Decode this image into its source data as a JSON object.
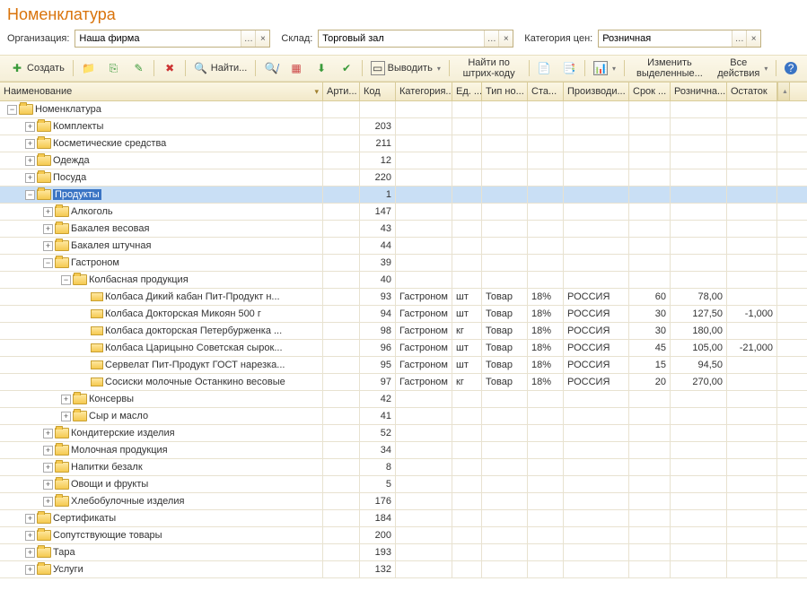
{
  "title": "Номенклатура",
  "filters": {
    "org_label": "Организация:",
    "org_value": "Наша фирма",
    "wh_label": "Склад:",
    "wh_value": "Торговый зал",
    "cat_label": "Категория цен:",
    "cat_value": "Розничная"
  },
  "toolbar": {
    "create": "Создать",
    "find": "Найти...",
    "output": "Выводить",
    "barcode": "Найти по штрих-коду",
    "change": "Изменить выделенные...",
    "all": "Все действия"
  },
  "columns": {
    "c0": "Наименование",
    "c1": "Арти...",
    "c2": "Код",
    "c3": "Категория...",
    "c4": "Ед. ...",
    "c5": "Тип но...",
    "c6": "Ста...",
    "c7": "Производи...",
    "c8": "Срок ...",
    "c9": "Рознична...",
    "c10": "Остаток"
  },
  "rows": [
    {
      "type": "folder",
      "depth": 0,
      "exp": "-",
      "sel": false,
      "name": "Номенклатура",
      "code": ""
    },
    {
      "type": "folder",
      "depth": 1,
      "exp": "+",
      "sel": false,
      "name": "Комплекты",
      "code": "203"
    },
    {
      "type": "folder",
      "depth": 1,
      "exp": "+",
      "sel": false,
      "name": "Косметические средства",
      "code": "211"
    },
    {
      "type": "folder",
      "depth": 1,
      "exp": "+",
      "sel": false,
      "name": "Одежда",
      "code": "12"
    },
    {
      "type": "folder",
      "depth": 1,
      "exp": "+",
      "sel": false,
      "name": "Посуда",
      "code": "220"
    },
    {
      "type": "folder",
      "depth": 1,
      "exp": "-",
      "sel": true,
      "name": "Продукты",
      "code": "1"
    },
    {
      "type": "folder",
      "depth": 2,
      "exp": "+",
      "sel": false,
      "name": "Алкоголь",
      "code": "147"
    },
    {
      "type": "folder",
      "depth": 2,
      "exp": "+",
      "sel": false,
      "name": "Бакалея весовая",
      "code": "43"
    },
    {
      "type": "folder",
      "depth": 2,
      "exp": "+",
      "sel": false,
      "name": "Бакалея штучная",
      "code": "44"
    },
    {
      "type": "folder",
      "depth": 2,
      "exp": "-",
      "sel": false,
      "name": "Гастроном",
      "code": "39"
    },
    {
      "type": "folder",
      "depth": 3,
      "exp": "-",
      "sel": false,
      "name": "Колбасная продукция",
      "code": "40"
    },
    {
      "type": "item",
      "depth": 4,
      "exp": "",
      "sel": false,
      "name": "Колбаса Дикий кабан Пит-Продукт н...",
      "code": "93",
      "cat": "Гастроном",
      "unit": "шт",
      "nt": "Товар",
      "vat": "18%",
      "prod": "РОССИЯ",
      "srok": "60",
      "price": "78,00",
      "rest": ""
    },
    {
      "type": "item",
      "depth": 4,
      "exp": "",
      "sel": false,
      "name": "Колбаса Докторская Микоян 500 г",
      "code": "94",
      "cat": "Гастроном",
      "unit": "шт",
      "nt": "Товар",
      "vat": "18%",
      "prod": "РОССИЯ",
      "srok": "30",
      "price": "127,50",
      "rest": "-1,000"
    },
    {
      "type": "item",
      "depth": 4,
      "exp": "",
      "sel": false,
      "name": "Колбаса докторская Петербурженка ...",
      "code": "98",
      "cat": "Гастроном",
      "unit": "кг",
      "nt": "Товар",
      "vat": "18%",
      "prod": "РОССИЯ",
      "srok": "30",
      "price": "180,00",
      "rest": ""
    },
    {
      "type": "item",
      "depth": 4,
      "exp": "",
      "sel": false,
      "name": "Колбаса Царицыно Советская сырок...",
      "code": "96",
      "cat": "Гастроном",
      "unit": "шт",
      "nt": "Товар",
      "vat": "18%",
      "prod": "РОССИЯ",
      "srok": "45",
      "price": "105,00",
      "rest": "-21,000"
    },
    {
      "type": "item",
      "depth": 4,
      "exp": "",
      "sel": false,
      "name": "Сервелат Пит-Продукт ГОСТ нарезка...",
      "code": "95",
      "cat": "Гастроном",
      "unit": "шт",
      "nt": "Товар",
      "vat": "18%",
      "prod": "РОССИЯ",
      "srok": "15",
      "price": "94,50",
      "rest": ""
    },
    {
      "type": "item",
      "depth": 4,
      "exp": "",
      "sel": false,
      "name": "Сосиски молочные Останкино весовые",
      "code": "97",
      "cat": "Гастроном",
      "unit": "кг",
      "nt": "Товар",
      "vat": "18%",
      "prod": "РОССИЯ",
      "srok": "20",
      "price": "270,00",
      "rest": ""
    },
    {
      "type": "folder",
      "depth": 3,
      "exp": "+",
      "sel": false,
      "name": "Консервы",
      "code": "42"
    },
    {
      "type": "folder",
      "depth": 3,
      "exp": "+",
      "sel": false,
      "name": "Сыр и масло",
      "code": "41"
    },
    {
      "type": "folder",
      "depth": 2,
      "exp": "+",
      "sel": false,
      "name": "Кондитерские изделия",
      "code": "52"
    },
    {
      "type": "folder",
      "depth": 2,
      "exp": "+",
      "sel": false,
      "name": "Молочная продукция",
      "code": "34"
    },
    {
      "type": "folder",
      "depth": 2,
      "exp": "+",
      "sel": false,
      "name": "Напитки безалк",
      "code": "8"
    },
    {
      "type": "folder",
      "depth": 2,
      "exp": "+",
      "sel": false,
      "name": "Овощи и фрукты",
      "code": "5"
    },
    {
      "type": "folder",
      "depth": 2,
      "exp": "+",
      "sel": false,
      "name": "Хлебобулочные изделия",
      "code": "176"
    },
    {
      "type": "folder",
      "depth": 1,
      "exp": "+",
      "sel": false,
      "name": "Сертификаты",
      "code": "184"
    },
    {
      "type": "folder",
      "depth": 1,
      "exp": "+",
      "sel": false,
      "name": "Сопутствующие товары",
      "code": "200"
    },
    {
      "type": "folder",
      "depth": 1,
      "exp": "+",
      "sel": false,
      "name": "Тара",
      "code": "193"
    },
    {
      "type": "folder",
      "depth": 1,
      "exp": "+",
      "sel": false,
      "name": "Услуги",
      "code": "132"
    }
  ]
}
